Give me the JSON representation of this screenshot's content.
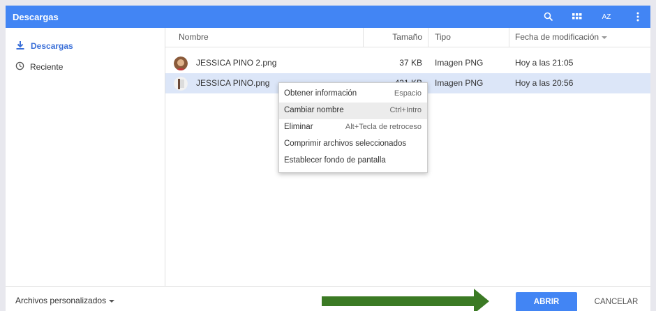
{
  "window": {
    "title": "Descargas"
  },
  "toolbar": {
    "search_icon": "search-icon",
    "grid_icon": "grid-icon",
    "sort_label": "AZ",
    "more_icon": "more-vert-icon"
  },
  "sidebar": {
    "items": [
      {
        "label": "Descargas",
        "icon": "download-icon",
        "active": true
      },
      {
        "label": "Reciente",
        "icon": "clock-icon",
        "active": false
      }
    ]
  },
  "columns": {
    "name": "Nombre",
    "size": "Tamaño",
    "type": "Tipo",
    "date": "Fecha de modificación"
  },
  "files": [
    {
      "name": "JESSICA PINO 2.png",
      "size": "37 KB",
      "type": "Imagen PNG",
      "date": "Hoy a las 21:05"
    },
    {
      "name": "JESSICA PINO.png",
      "size": "431 KB",
      "type": "Imagen PNG",
      "date": "Hoy a las 20:56"
    }
  ],
  "context_menu": {
    "items": [
      {
        "label": "Obtener información",
        "shortcut": "Espacio"
      },
      {
        "label": "Cambiar nombre",
        "shortcut": "Ctrl+Intro"
      },
      {
        "label": "Eliminar",
        "shortcut": "Alt+Tecla de retroceso"
      },
      {
        "label": "Comprimir archivos seleccionados",
        "shortcut": ""
      },
      {
        "label": "Establecer fondo de pantalla",
        "shortcut": ""
      }
    ]
  },
  "footer": {
    "filter_label": "Archivos personalizados",
    "open_label": "ABRIR",
    "cancel_label": "CANCELAR"
  },
  "colors": {
    "accent": "#4285f4",
    "selection": "#dce6f8",
    "arrow": "#3b7a24"
  }
}
